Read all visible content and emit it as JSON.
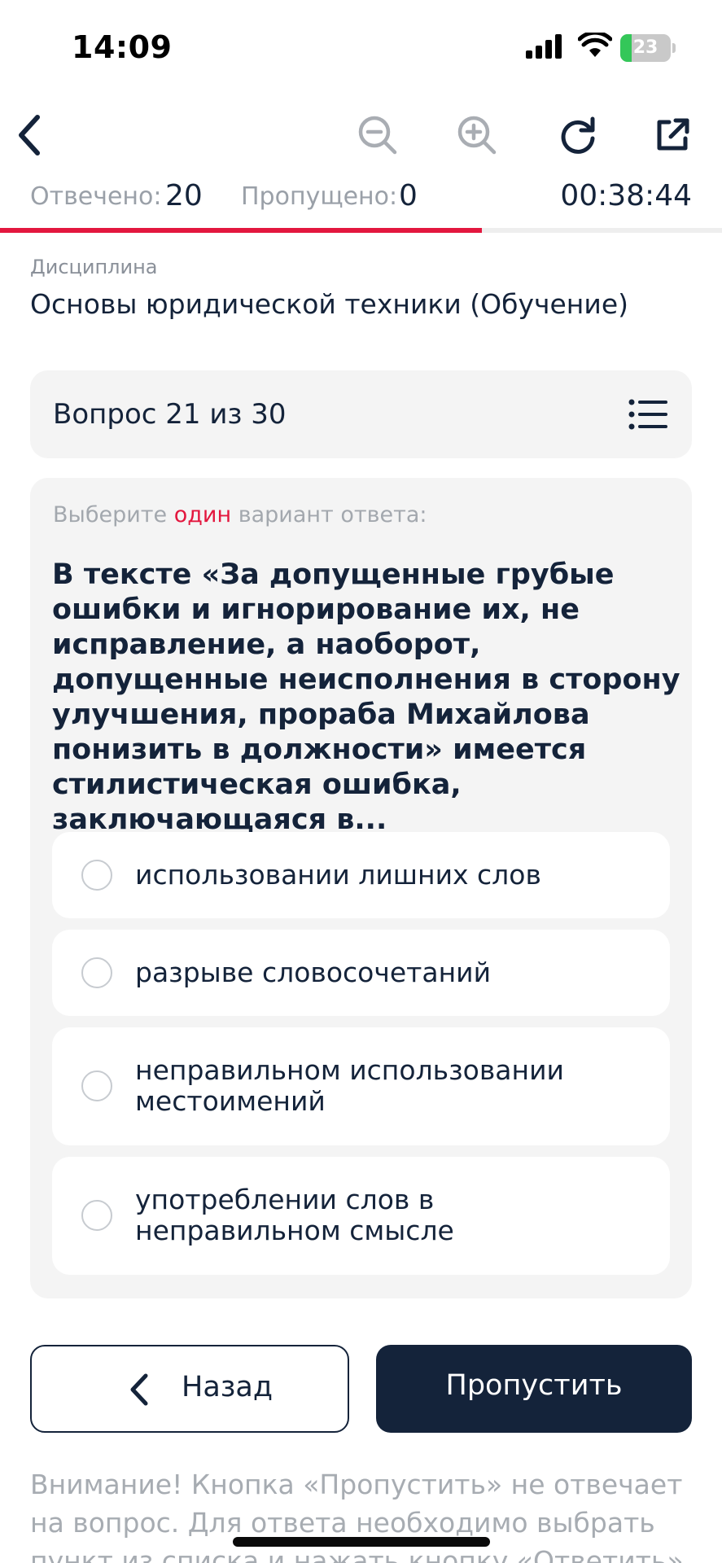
{
  "status_bar": {
    "time": "14:09",
    "battery": "23",
    "battery_level": 0.23
  },
  "stats": {
    "answered_label": "Отвечено:",
    "answered_value": "20",
    "skipped_label": "Пропущено:",
    "skipped_value": "0",
    "timer": "00:38:44",
    "progress": 0.667
  },
  "discipline": {
    "label": "Дисциплина",
    "name": "Основы юридической техники (Обучение)"
  },
  "question": {
    "header": "Вопрос 21 из 30",
    "hint_prefix": "Выберите ",
    "hint_accent": "один",
    "hint_suffix": " вариант ответа:",
    "text": "В тексте «За допущенные грубые ошибки и игнорирование их, не исправление, а наоборот, допущенные неисполнения в сторону улучшения, прораба Михайлова понизить в должности» имеется стилистическая ошибка, заключающаяся в...",
    "options": [
      {
        "label": "использовании лишних слов"
      },
      {
        "label": "разрыве словосочетаний"
      },
      {
        "label": "неправильном использовании местоимений"
      },
      {
        "label": "употреблении слов в неправильном смысле"
      }
    ]
  },
  "buttons": {
    "back": "Назад",
    "skip": "Пропустить"
  },
  "warning": "Внимание! Кнопка «Пропустить» не отвечает на вопрос. Для ответа необходимо выбрать пункт из списка и нажать кнопку «Ответить».",
  "colors": {
    "accent": "#e3173e",
    "primary": "#14233a",
    "card": "#f4f4f4"
  }
}
